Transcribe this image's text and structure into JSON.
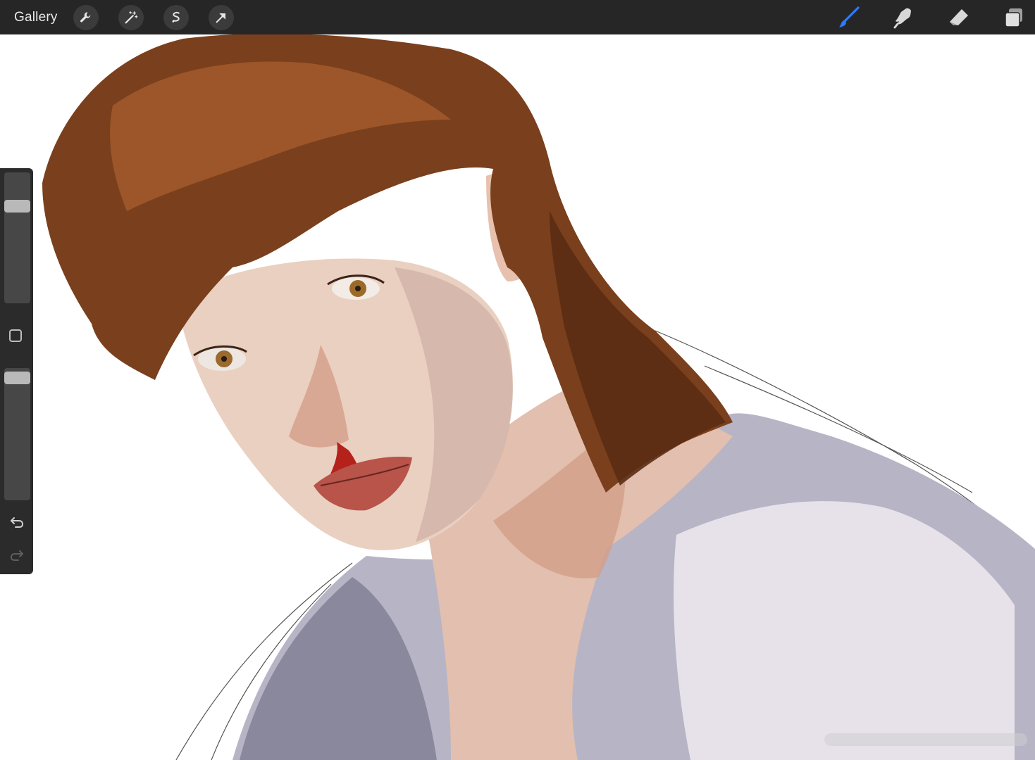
{
  "topbar": {
    "gallery_label": "Gallery",
    "left_tools": [
      "wrench-icon",
      "magic-wand-icon",
      "selection-icon",
      "transform-arrow-icon"
    ],
    "right_tools": [
      "brush-icon",
      "smudge-icon",
      "eraser-icon",
      "layers-icon"
    ],
    "active_tool": "brush-icon",
    "accent_color": "#2f7bf5"
  },
  "sidebar": {
    "brush_size_level": 0.77,
    "brush_opacity_level": 0.97,
    "controls": [
      "modify-button-icon",
      "undo-icon",
      "redo-icon"
    ]
  },
  "colors": {
    "toolbar_bg": "#262626",
    "canvas_bg": "#ffffff",
    "hair": "#7a3f1c",
    "skin": "#e8c7b6",
    "shirt": "#b7b4c6",
    "blood": "#b5221c"
  }
}
